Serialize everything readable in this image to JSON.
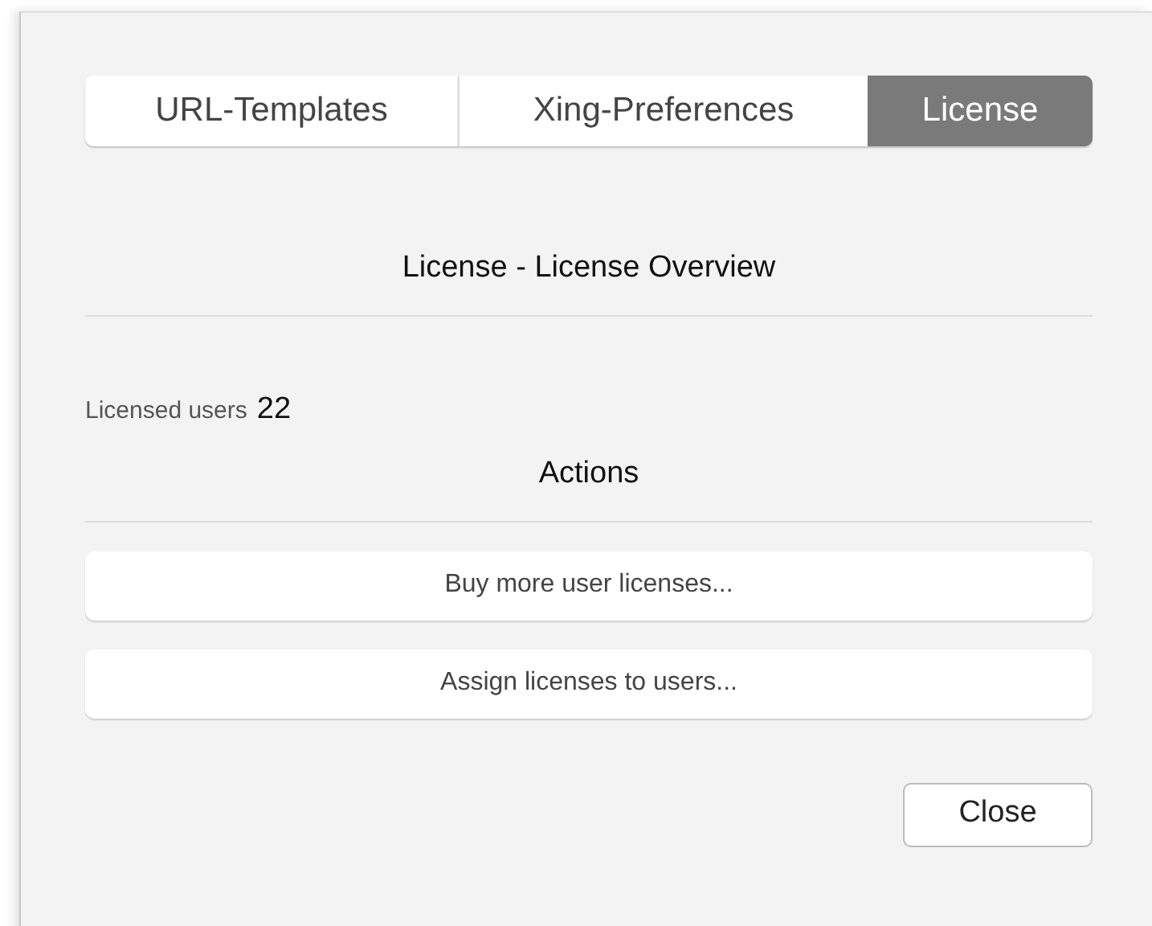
{
  "tabs": [
    {
      "label": "URL-Templates",
      "selected": false
    },
    {
      "label": "Xing-Preferences",
      "selected": false
    },
    {
      "label": "License",
      "selected": true
    }
  ],
  "heading": "License - License Overview",
  "licensed_users": {
    "label": "Licensed users",
    "value": "22"
  },
  "actions": {
    "title": "Actions",
    "buttons": [
      "Buy more user licenses...",
      "Assign licenses to users..."
    ]
  },
  "close_button": "Close"
}
